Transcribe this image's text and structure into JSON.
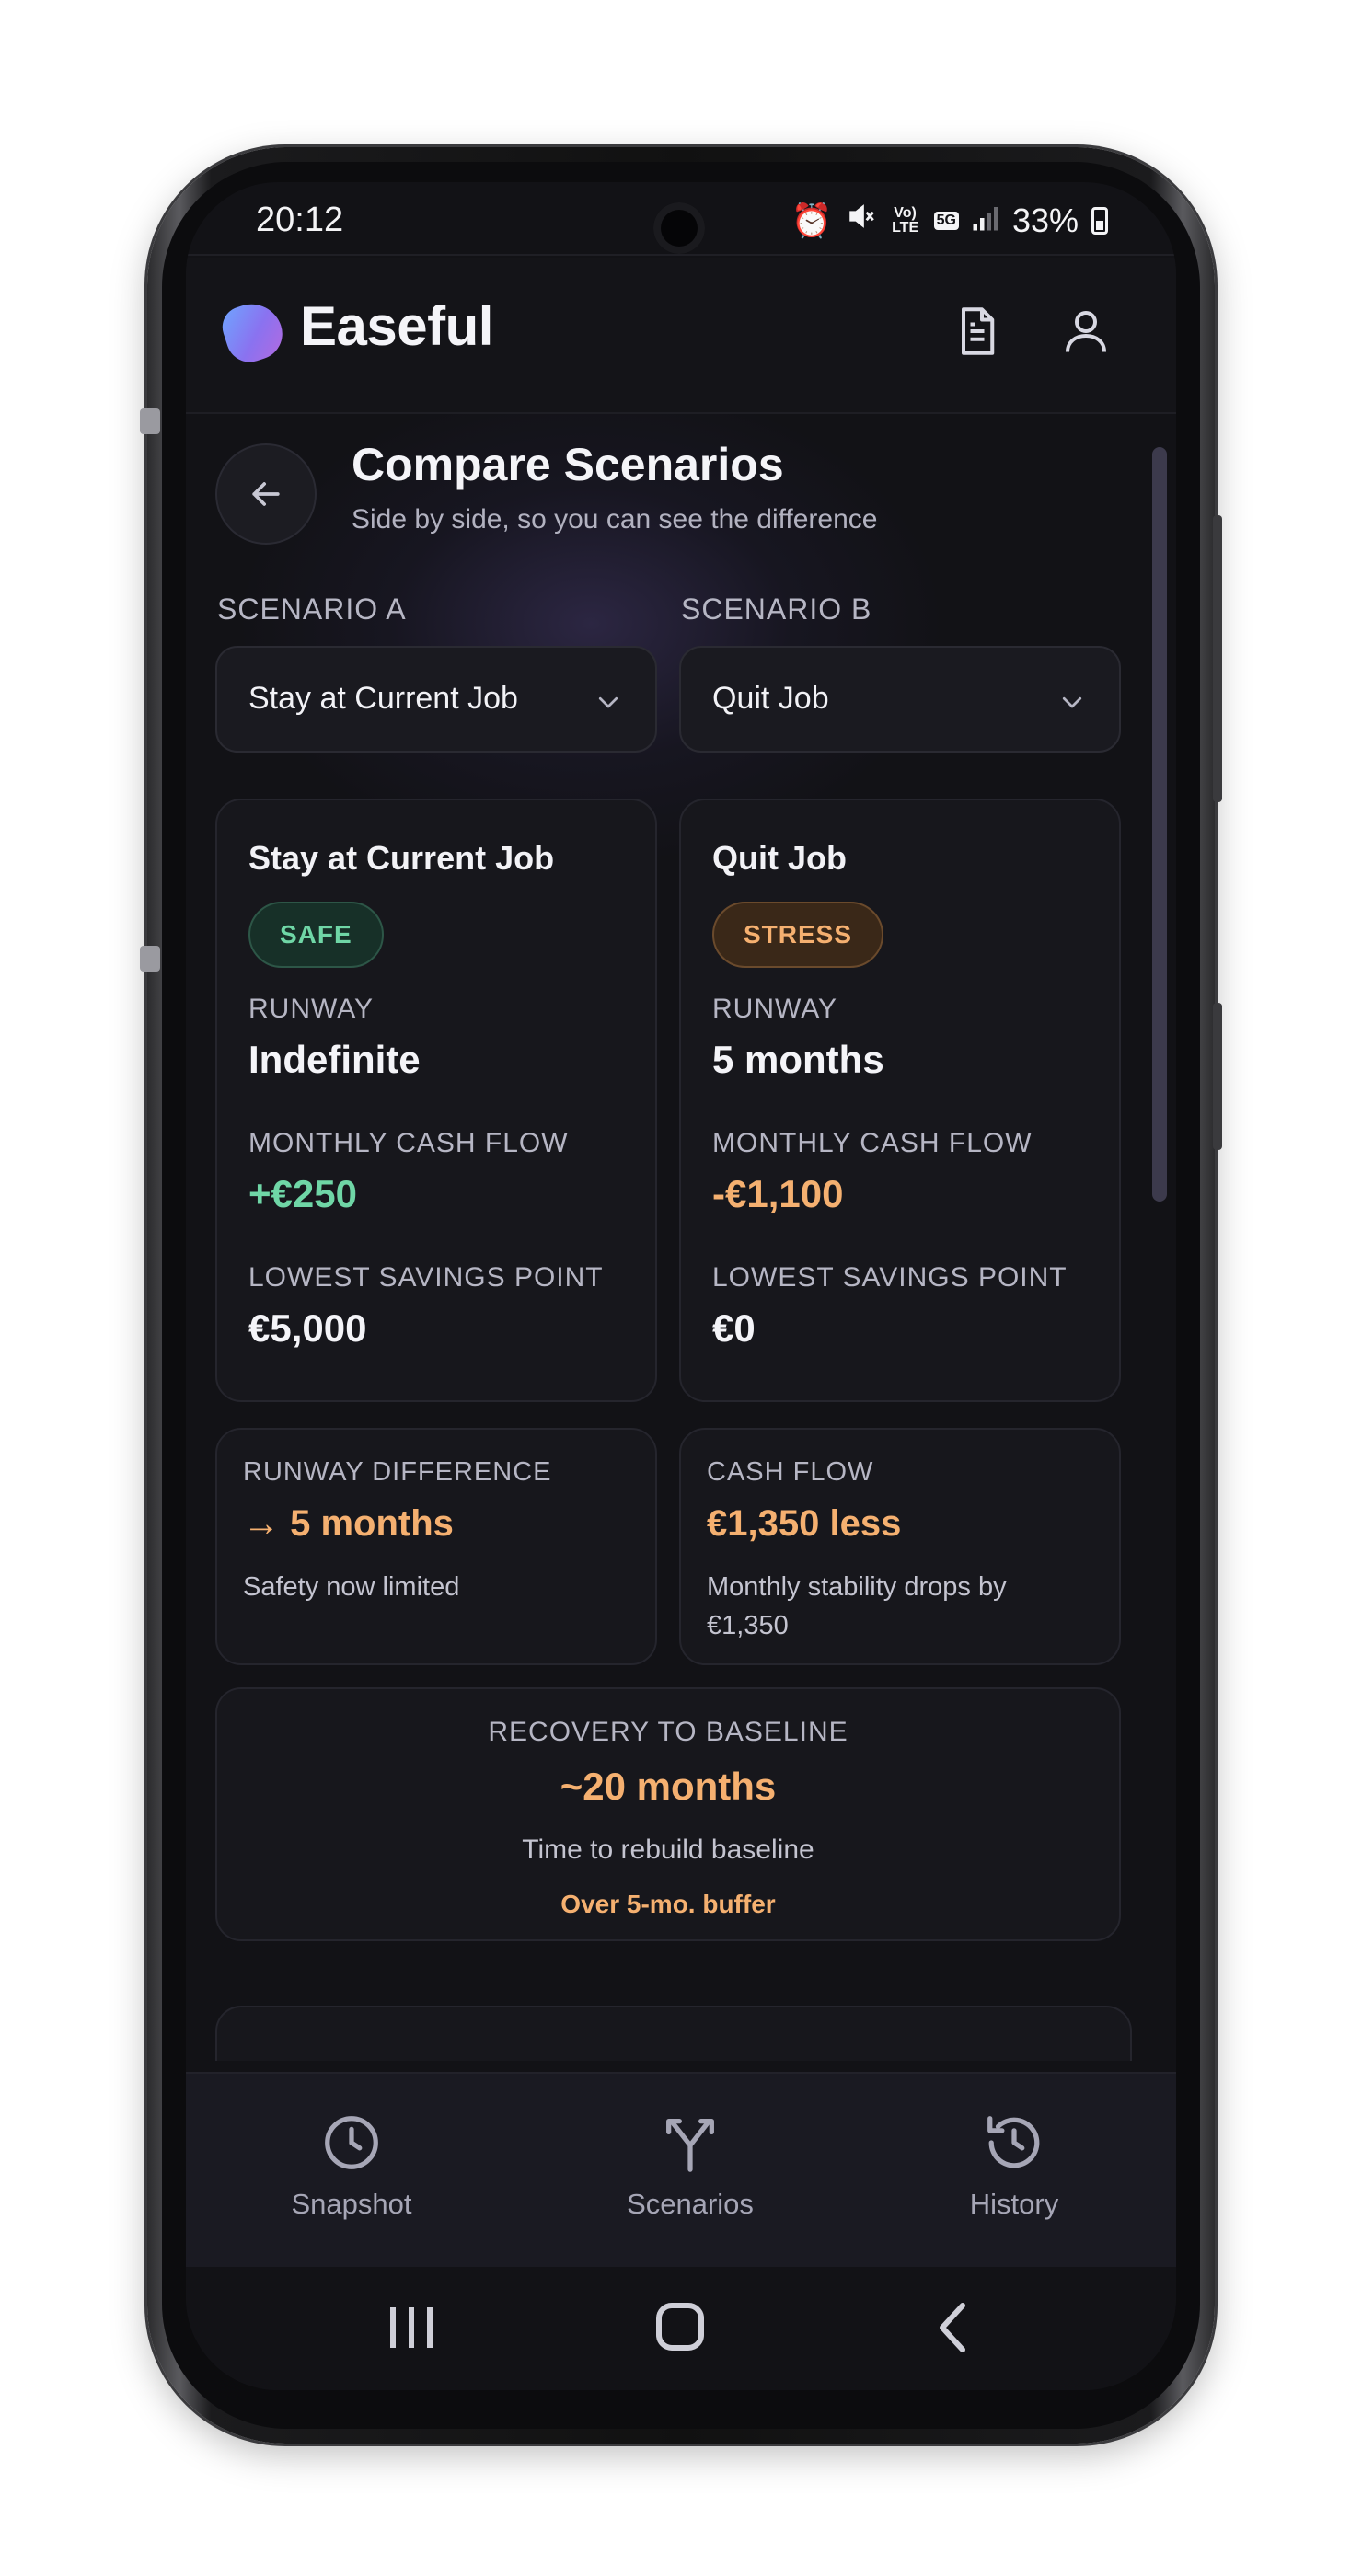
{
  "status_bar": {
    "time": "20:12",
    "battery": "33%",
    "network_badge": "5G",
    "volte": "Vo) LTE"
  },
  "header": {
    "brand": "Easeful"
  },
  "page": {
    "title": "Compare Scenarios",
    "subtitle": "Side by side, so you can see the difference"
  },
  "scenario_a": {
    "label": "SCENARIO A",
    "selected": "Stay at Current Job",
    "card": {
      "title": "Stay at Current Job",
      "badge": "SAFE",
      "runway_label": "RUNWAY",
      "runway_value": "Indefinite",
      "cash_flow_label": "MONTHLY CASH FLOW",
      "cash_flow_value": "+€250",
      "lowest_label": "LOWEST SAVINGS POINT",
      "lowest_value": "€5,000"
    }
  },
  "scenario_b": {
    "label": "SCENARIO B",
    "selected": "Quit Job",
    "card": {
      "title": "Quit Job",
      "badge": "STRESS",
      "runway_label": "RUNWAY",
      "runway_value": "5 months",
      "cash_flow_label": "MONTHLY CASH FLOW",
      "cash_flow_value": "-€1,100",
      "lowest_label": "LOWEST SAVINGS POINT",
      "lowest_value": "€0"
    }
  },
  "comparison": {
    "runway": {
      "label": "RUNWAY DIFFERENCE",
      "value": "→ 5 months",
      "description": "Safety now limited"
    },
    "cash_flow": {
      "label": "CASH FLOW",
      "value": "€1,350 less",
      "description": "Monthly stability drops by €1,350"
    },
    "recovery": {
      "label": "RECOVERY TO BASELINE",
      "value": "~20 months",
      "description": "Time to rebuild baseline",
      "note": "Over 5-mo. buffer"
    }
  },
  "bottom_nav": {
    "items": [
      {
        "label": "Snapshot",
        "icon": "clock-icon"
      },
      {
        "label": "Scenarios",
        "icon": "split-arrows-icon"
      },
      {
        "label": "History",
        "icon": "history-icon"
      }
    ]
  },
  "colors": {
    "background": "#121216",
    "positive": "#6fd6a6",
    "warning": "#f5b070",
    "card": "#17171c"
  }
}
